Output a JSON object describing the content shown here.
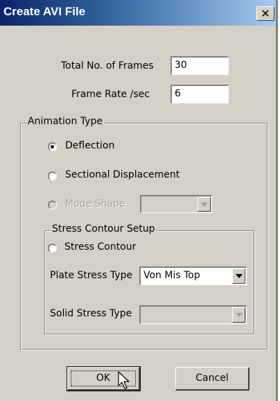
{
  "window": {
    "title": "Create AVI File",
    "close_glyph": "✕"
  },
  "fields": {
    "total_frames_label": "Total No. of Frames",
    "total_frames_value": "30",
    "frame_rate_label": "Frame Rate /sec",
    "frame_rate_value": "6"
  },
  "animation_type": {
    "legend": "Animation Type",
    "options": [
      {
        "label": "Deflection",
        "selected": true,
        "enabled": true
      },
      {
        "label": "Sectional Displacement",
        "selected": false,
        "enabled": true
      },
      {
        "label": "Mode Shape",
        "selected": false,
        "enabled": false
      }
    ],
    "mode_shape_value": ""
  },
  "stress_contour": {
    "legend": "Stress Contour Setup",
    "radio_label": "Stress Contour",
    "plate_stress_label": "Plate Stress Type",
    "plate_stress_value": "Von Mis Top",
    "solid_stress_label": "Solid Stress Type",
    "solid_stress_value": ""
  },
  "buttons": {
    "ok": "OK",
    "cancel": "Cancel"
  },
  "icons": {
    "close": "close-icon",
    "cursor": "mouse-pointer-icon",
    "dropdown": "chevron-down-icon"
  },
  "colors": {
    "titlebar_start": "#0a246a",
    "titlebar_end": "#a6caf0",
    "dialog_bg": "#d4d0c8"
  }
}
